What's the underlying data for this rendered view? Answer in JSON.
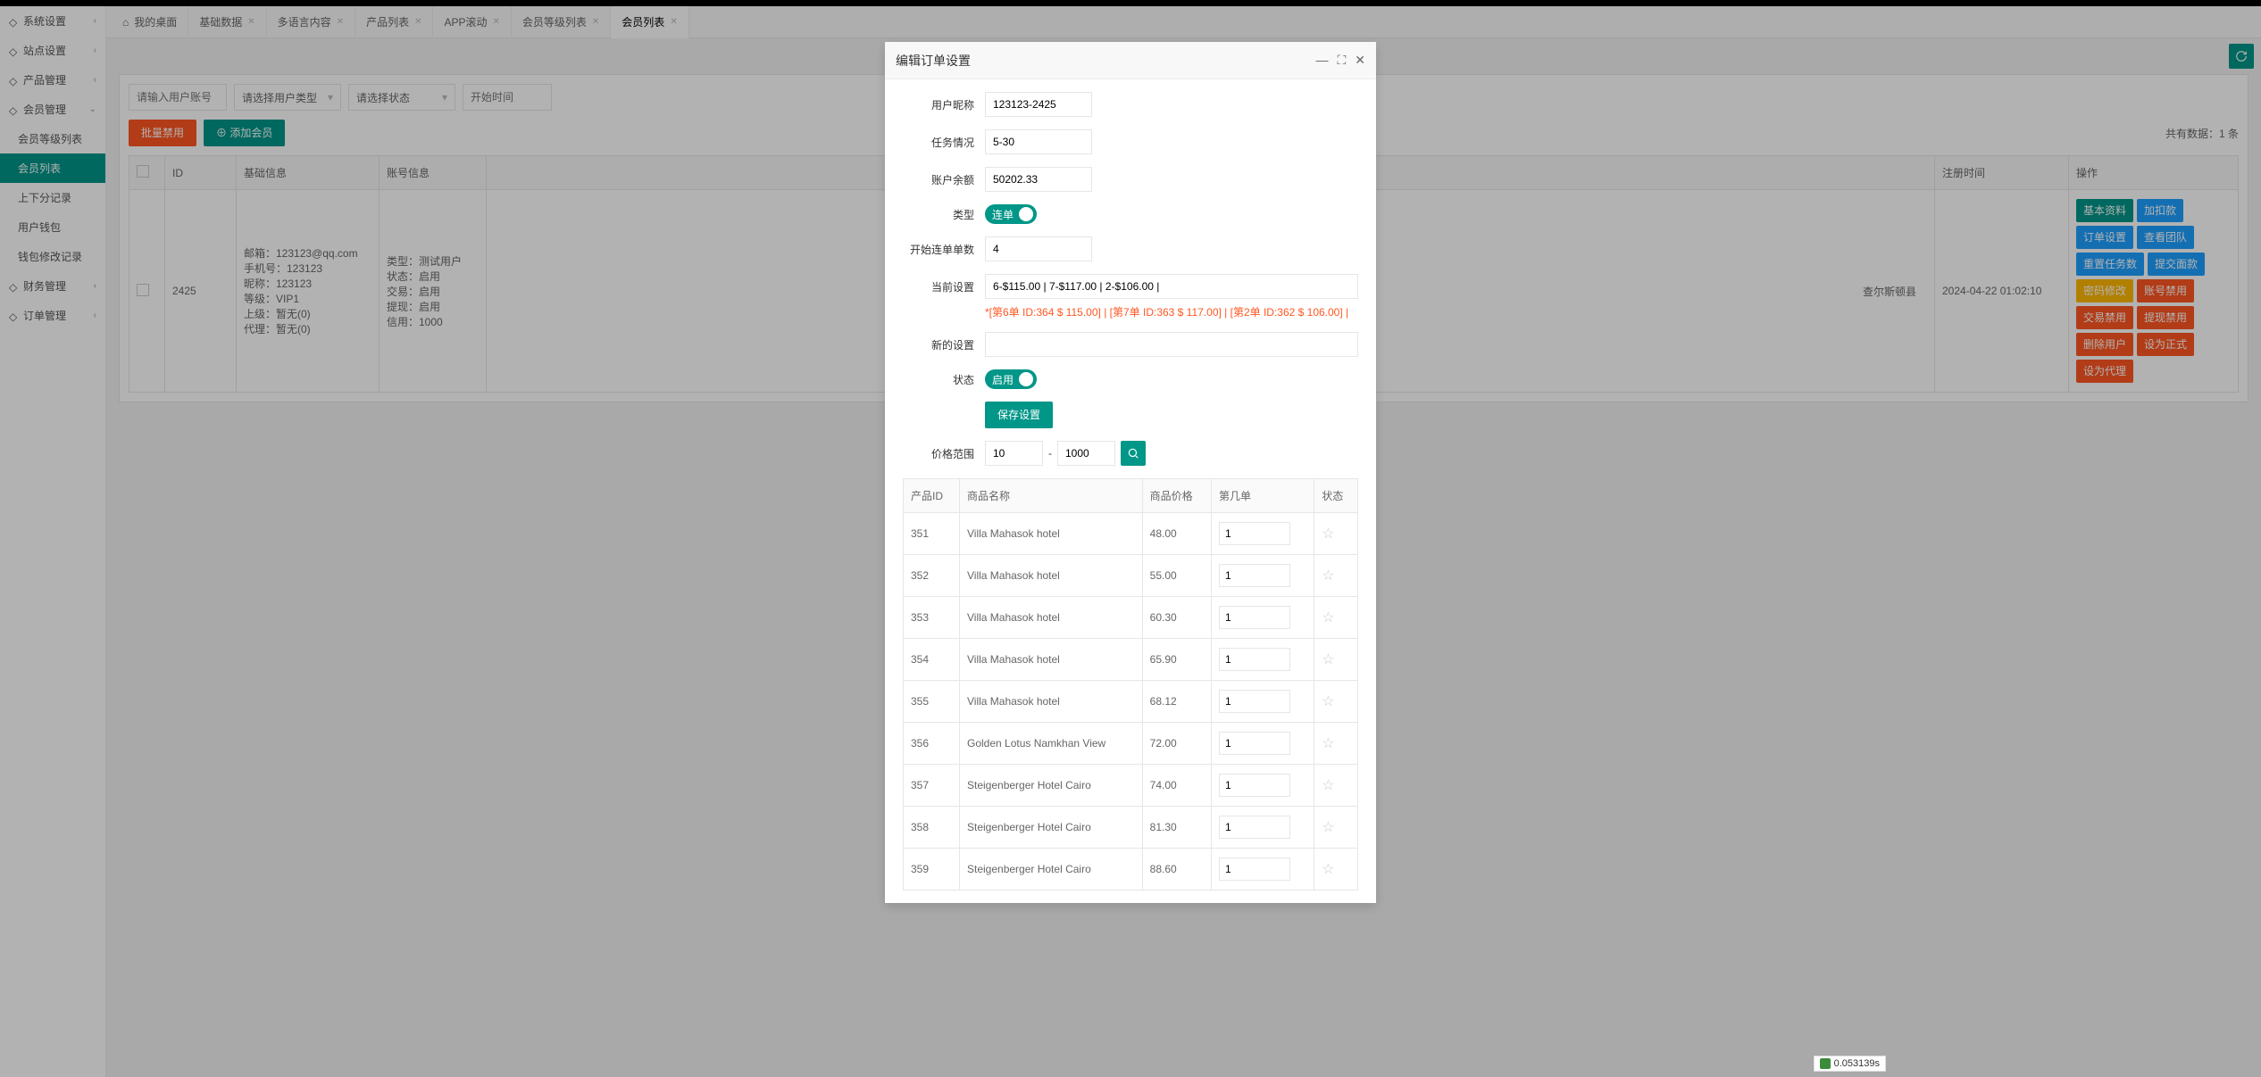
{
  "sidebar": {
    "items": [
      {
        "label": "系统设置",
        "arrow": "‹"
      },
      {
        "label": "站点设置",
        "arrow": "‹"
      },
      {
        "label": "产品管理",
        "arrow": "‹"
      },
      {
        "label": "会员管理",
        "arrow": "⌄"
      }
    ],
    "subs": [
      {
        "label": "会员等级列表"
      },
      {
        "label": "会员列表",
        "active": true
      },
      {
        "label": "上下分记录"
      },
      {
        "label": "用户钱包"
      },
      {
        "label": "钱包修改记录"
      }
    ],
    "items2": [
      {
        "label": "财务管理",
        "arrow": "‹"
      },
      {
        "label": "订单管理",
        "arrow": "‹"
      }
    ]
  },
  "tabs": [
    {
      "label": "我的桌面",
      "home": true
    },
    {
      "label": "基础数据",
      "close": true
    },
    {
      "label": "多语言内容",
      "close": true
    },
    {
      "label": "产品列表",
      "close": true
    },
    {
      "label": "APP滚动",
      "close": true
    },
    {
      "label": "会员等级列表",
      "close": true
    },
    {
      "label": "会员列表",
      "close": true,
      "active": true
    }
  ],
  "filters": {
    "user_placeholder": "请输入用户账号",
    "type_placeholder": "请选择用户类型",
    "status_placeholder": "请选择状态",
    "start_placeholder": "开始时间"
  },
  "actions": {
    "batch_disable": "批量禁用",
    "add_member": "添加会员",
    "data_count": "共有数据：1 条"
  },
  "table": {
    "headers": {
      "chk": "",
      "id": "ID",
      "basic": "基础信息",
      "account": "账号信息",
      "reg_time": "注册时间",
      "ops": "操作"
    },
    "row": {
      "id": "2425",
      "basic_lines": [
        "邮箱：123123@qq.com",
        "手机号：123123",
        "昵称：123123",
        "等级：VIP1",
        "上级：暂无(0)",
        "代理：暂无(0)"
      ],
      "account_lines": [
        "类型：测试用户",
        "状态：启用",
        "交易：启用",
        "提现：启用",
        "信用：1000"
      ],
      "location": "查尔斯顿县",
      "reg_time": "2024-04-22 01:02:10",
      "ops": [
        {
          "t": "基本资料",
          "c": "c-teal"
        },
        {
          "t": "加扣款",
          "c": "c-blue"
        },
        {
          "t": "订单设置",
          "c": "c-blue"
        },
        {
          "t": "查看团队",
          "c": "c-blue"
        },
        {
          "t": "重置任务数",
          "c": "c-blue"
        },
        {
          "t": "提交面款",
          "c": "c-blue"
        },
        {
          "t": "密码修改",
          "c": "c-orange"
        },
        {
          "t": "账号禁用",
          "c": "c-red"
        },
        {
          "t": "交易禁用",
          "c": "c-red"
        },
        {
          "t": "提现禁用",
          "c": "c-red"
        },
        {
          "t": "删除用户",
          "c": "c-red"
        },
        {
          "t": "设为正式",
          "c": "c-red"
        },
        {
          "t": "设为代理",
          "c": "c-red"
        }
      ]
    }
  },
  "modal": {
    "title": "编辑订单设置",
    "fields": {
      "nickname": {
        "label": "用户昵称",
        "value": "123123-2425"
      },
      "task": {
        "label": "任务情况",
        "value": "5-30"
      },
      "balance": {
        "label": "账户余额",
        "value": "50202.33"
      },
      "type": {
        "label": "类型",
        "switch": "连单"
      },
      "start_count": {
        "label": "开始连单单数",
        "value": "4"
      },
      "current": {
        "label": "当前设置",
        "value": "6-$115.00 | 7-$117.00 | 2-$106.00 |",
        "note": "*[第6单 ID:364 $ 115.00] | [第7单 ID:363 $ 117.00] | [第2单 ID:362 $ 106.00] |"
      },
      "new": {
        "label": "新的设置",
        "value": ""
      },
      "status": {
        "label": "状态",
        "switch": "启用"
      },
      "save": "保存设置",
      "price_range": {
        "label": "价格范围",
        "from": "10",
        "to": "1000"
      }
    },
    "ptable": {
      "headers": {
        "pid": "产品ID",
        "pname": "商品名称",
        "pprice": "商品价格",
        "porder": "第几单",
        "pstatus": "状态"
      },
      "rows": [
        {
          "id": "351",
          "name": "Villa Mahasok hotel",
          "price": "48.00",
          "order": "1"
        },
        {
          "id": "352",
          "name": "Villa Mahasok hotel",
          "price": "55.00",
          "order": "1"
        },
        {
          "id": "353",
          "name": "Villa Mahasok hotel",
          "price": "60.30",
          "order": "1"
        },
        {
          "id": "354",
          "name": "Villa Mahasok hotel",
          "price": "65.90",
          "order": "1"
        },
        {
          "id": "355",
          "name": "Villa Mahasok hotel",
          "price": "68.12",
          "order": "1"
        },
        {
          "id": "356",
          "name": "Golden Lotus Namkhan View",
          "price": "72.00",
          "order": "1"
        },
        {
          "id": "357",
          "name": "Steigenberger Hotel Cairo",
          "price": "74.00",
          "order": "1"
        },
        {
          "id": "358",
          "name": "Steigenberger Hotel Cairo",
          "price": "81.30",
          "order": "1"
        },
        {
          "id": "359",
          "name": "Steigenberger Hotel Cairo",
          "price": "88.60",
          "order": "1"
        }
      ]
    }
  },
  "perf": "0.053139s"
}
